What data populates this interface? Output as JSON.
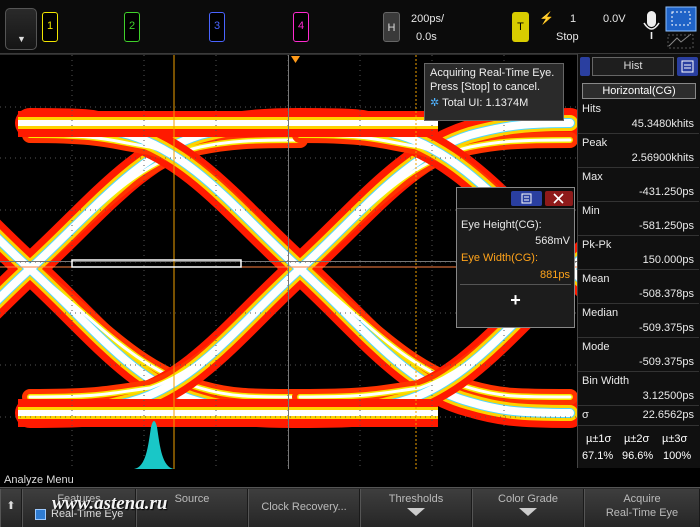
{
  "toolbar": {
    "channels": [
      {
        "label": "1",
        "color": "#f2e600"
      },
      {
        "label": "2",
        "color": "#3fd12a"
      },
      {
        "label": "3",
        "color": "#4a64ff"
      },
      {
        "label": "4",
        "color": "#ff2ad0"
      }
    ],
    "horizontal": {
      "badge": "H",
      "scale": "200ps/",
      "position": "0.0s"
    },
    "trigger": {
      "badge": "T",
      "channel": "1",
      "level": "0.0V",
      "state": "Stop"
    }
  },
  "acquire_box": {
    "line1": "Acquiring Real-Time Eye.",
    "line2": "Press [Stop] to cancel.",
    "total_ui": "Total UI: 1.1374M"
  },
  "measurements": {
    "eye_height_label": "Eye Height(CG):",
    "eye_height_value": "568mV",
    "eye_width_label": "Eye Width(CG):",
    "eye_width_value": "881ps",
    "accent_color": "#ffa31a"
  },
  "side_panel": {
    "tab": "Hist",
    "source": "Horizontal(CG)",
    "stats": [
      {
        "label": "Hits",
        "value": "45.3480khits"
      },
      {
        "label": "Peak",
        "value": "2.56900khits"
      },
      {
        "label": "Max",
        "value": "-431.250ps"
      },
      {
        "label": "Min",
        "value": "-581.250ps"
      },
      {
        "label": "Pk-Pk",
        "value": "150.000ps"
      },
      {
        "label": "Mean",
        "value": "-508.378ps"
      },
      {
        "label": "Median",
        "value": "-509.375ps"
      },
      {
        "label": "Mode",
        "value": "-509.375ps"
      },
      {
        "label": "Bin Width",
        "value": "3.12500ps"
      },
      {
        "label": "σ",
        "value": "22.6562ps"
      }
    ],
    "sigma_headers": [
      "µ±1σ",
      "µ±2σ",
      "µ±3σ"
    ],
    "sigma_values": [
      "67.1%",
      "96.6%",
      "100%"
    ]
  },
  "bottom_menu": {
    "title": "Analyze Menu",
    "features_label": "Features",
    "features_value": "Real-Time Eye",
    "source_label": "Source",
    "clock_recovery": "Clock Recovery...",
    "thresholds": "Thresholds",
    "color_grade": "Color Grade",
    "acquire_label": "Acquire",
    "acquire_value": "Real-Time Eye"
  },
  "watermark": "www.astena.ru"
}
